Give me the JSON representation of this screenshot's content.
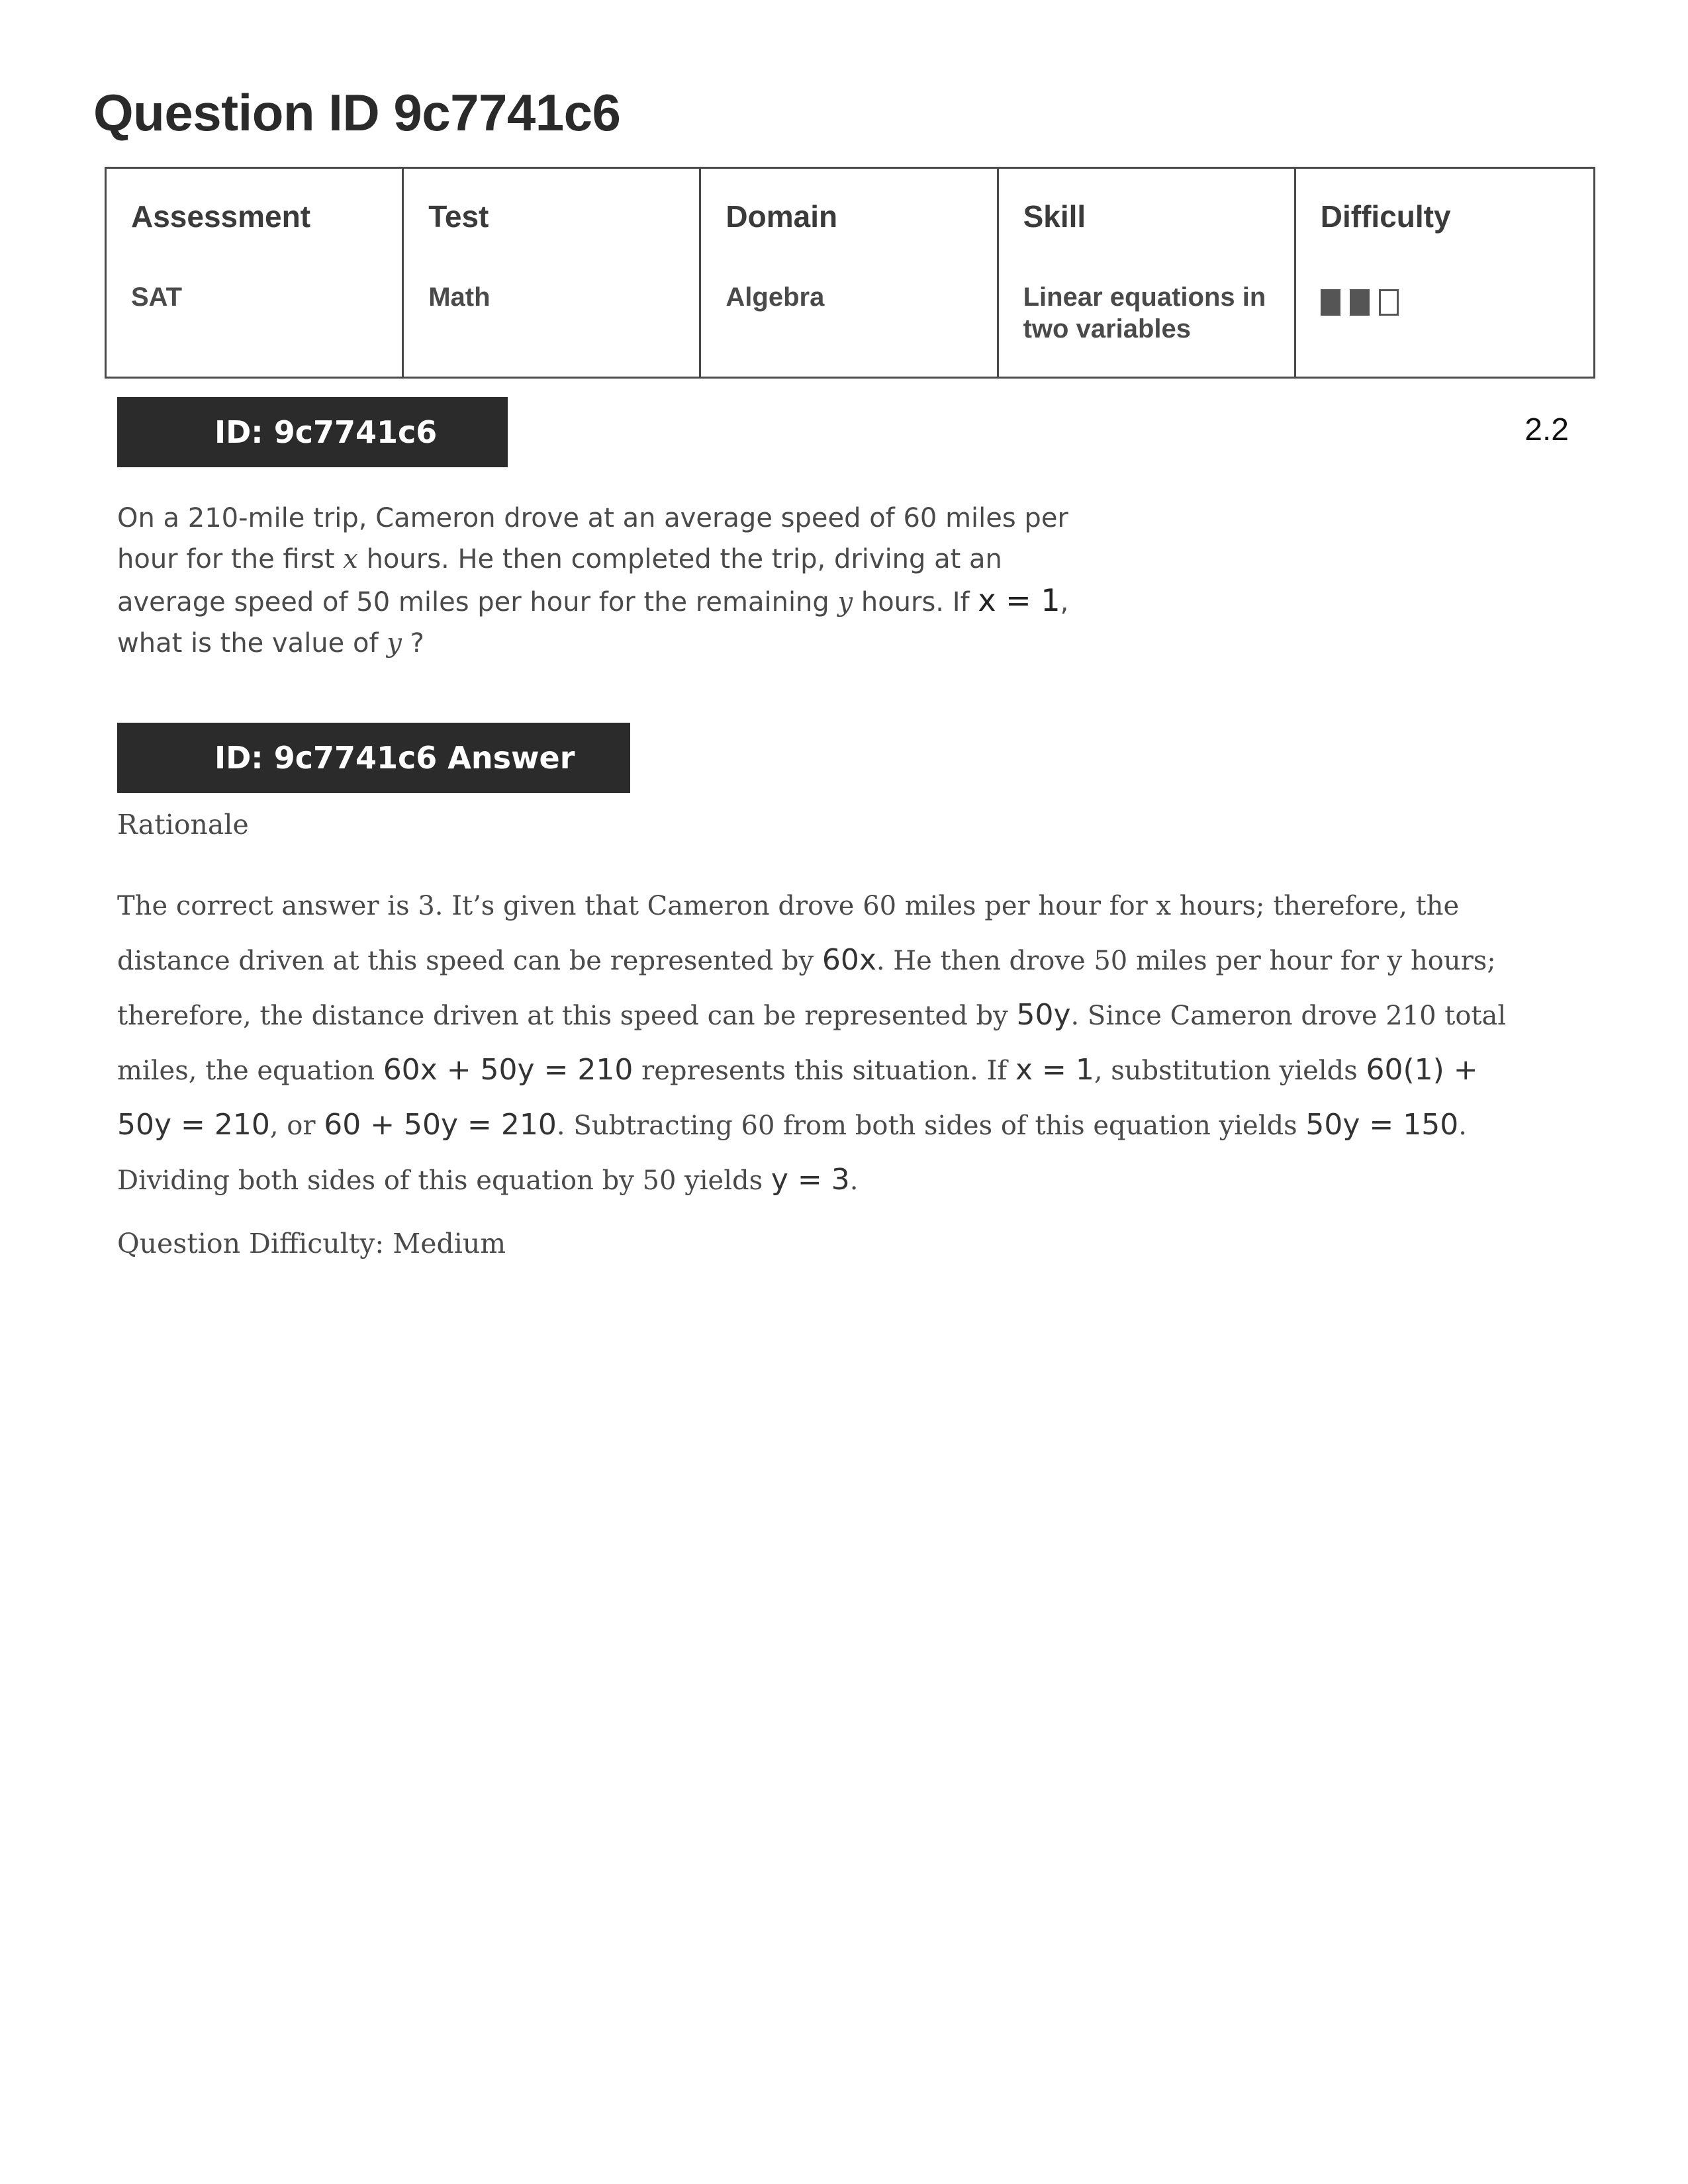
{
  "page_title": "Question ID 9c7741c6",
  "meta": {
    "headers": [
      "Assessment",
      "Test",
      "Domain",
      "Skill",
      "Difficulty"
    ],
    "values": [
      "SAT",
      "Math",
      "Algebra",
      "Linear equations in two variables"
    ],
    "difficulty_level": 2,
    "difficulty_max": 3,
    "difficulty_color": "#555555"
  },
  "question_bar": "ID: 9c7741c6",
  "version": "2.2",
  "question": {
    "t1": "On a 210-mile trip, Cameron drove at an average speed of 60 miles per hour for the first ",
    "v1": "x",
    "t2": " hours. He then completed the trip, driving at an average speed of 50 miles per hour for the remaining ",
    "v2": "y",
    "t3": " hours. If ",
    "m1": "x = 1",
    "t4": ", what is the value of ",
    "v3": "y",
    "t5": " ?"
  },
  "answer_bar": "ID: 9c7741c6 Answer",
  "rationale_label": "Rationale",
  "rationale": {
    "t1": "The correct answer is 3. It’s given that Cameron drove 60 miles per hour for x hours; therefore, the distance driven at this speed can be represented by ",
    "m1": "60x",
    "t2": ". He then drove 50 miles per hour for y hours; therefore, the distance driven at this speed can be represented by ",
    "m2": "50y",
    "t3": ". Since Cameron drove 210 total miles, the equation ",
    "m3": "60x + 50y = 210",
    "t4": " represents this situation. If ",
    "m4": "x = 1",
    "t5": ", substitution yields ",
    "m5": "60(1) + 50y = 210",
    "t6": ", or ",
    "m6": "60 + 50y = 210",
    "t7": ". Subtracting 60 from both sides of this equation yields ",
    "m7": "50y = 150",
    "t8": ". Dividing both sides of this equation by 50 yields ",
    "m8": "y = 3",
    "t9": "."
  },
  "difficulty_line": "Question Difficulty: Medium"
}
